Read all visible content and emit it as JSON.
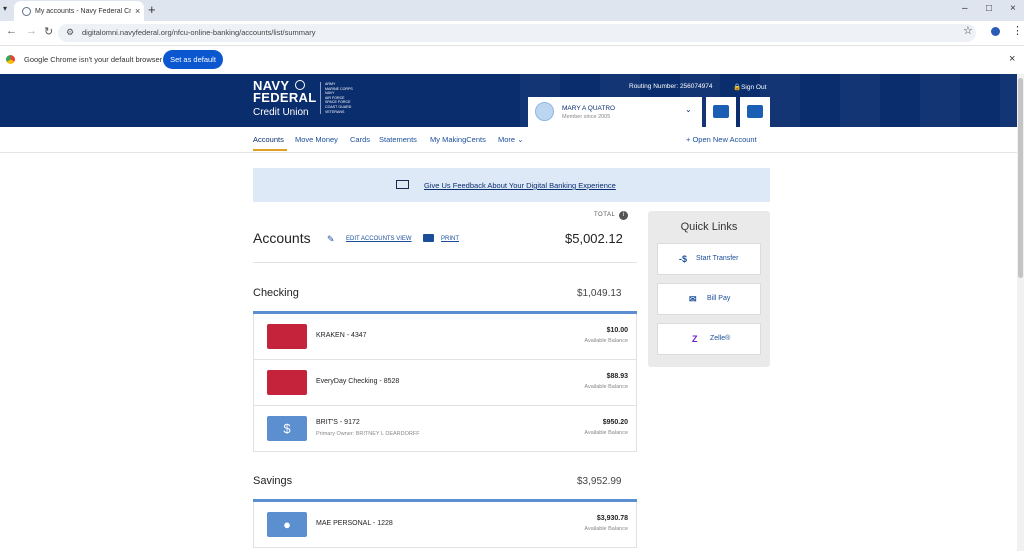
{
  "browser": {
    "tab_title": "My accounts - Navy Federal Cr...",
    "url": "digitalomni.navyfederal.org/nfcu-online-banking/accounts/list/summary",
    "default_msg": "Google Chrome isn't your default browser",
    "set_default_label": "Set as default",
    "new_tab_glyph": "+",
    "close_glyph": "×",
    "minimize_glyph": "–",
    "maximize_glyph": "□"
  },
  "header": {
    "logo_line1": "NAVY",
    "logo_line2": "FEDERAL",
    "logo_line3": "Credit Union",
    "branches": [
      "ARMY",
      "MARINE CORPS",
      "NAVY",
      "AIR FORCE",
      "SPACE FORCE",
      "COAST GUARD",
      "VETERANS"
    ],
    "routing": "Routing Number: 256074974",
    "sign_out": "Sign Out",
    "user_name": "MARY A QUATRO",
    "member_since": "Member since 2005",
    "accent_color": "#0a2d6e"
  },
  "nav": {
    "accounts": "Accounts",
    "move_money": "Move Money",
    "cards": "Cards",
    "statements": "Statements",
    "makingcents": "My MakingCents",
    "more": "More",
    "open_account": "+ Open New Account"
  },
  "feedback": {
    "text": "Give Us Feedback About Your Digital Banking Experience"
  },
  "accounts": {
    "title": "Accounts",
    "edit_label": "EDIT ACCOUNTS VIEW",
    "print_label": "PRINT",
    "total_label": "TOTAL",
    "total_value": "$5,002.12"
  },
  "checking": {
    "title": "Checking",
    "total": "$1,049.13",
    "rows": [
      {
        "name": "KRAKEN - 4347",
        "sub": "",
        "amount": "$10.00",
        "balance_label": "Available Balance"
      },
      {
        "name": "EveryDay Checking - 8528",
        "sub": "",
        "amount": "$88.93",
        "balance_label": "Available Balance"
      },
      {
        "name": "BRIT'S - 9172",
        "sub": "Primary Owner: BRITNEY L DEARDORFF",
        "amount": "$950.20",
        "balance_label": "Available Balance"
      }
    ]
  },
  "savings": {
    "title": "Savings",
    "total": "$3,952.99",
    "rows": [
      {
        "name": "MAE PERSONAL - 1228",
        "sub": "",
        "amount": "$3,930.78",
        "balance_label": "Available Balance"
      }
    ]
  },
  "quick_links": {
    "title": "Quick Links",
    "items": [
      {
        "label": "Start Transfer",
        "icon": "transfer-icon"
      },
      {
        "label": "Bill Pay",
        "icon": "bill-pay-icon"
      },
      {
        "label": "Zelle®",
        "icon": "zelle-icon"
      }
    ]
  }
}
